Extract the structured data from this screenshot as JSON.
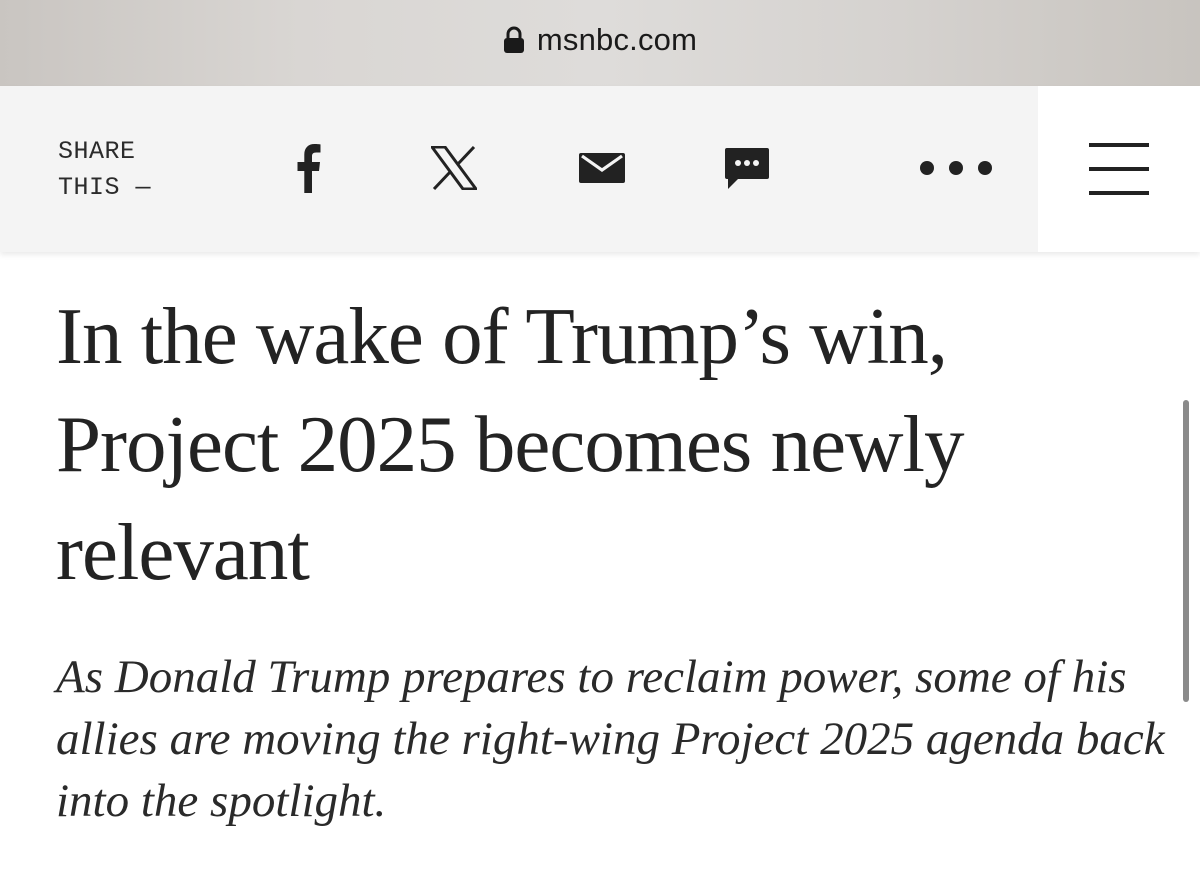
{
  "browser": {
    "url": "msnbc.com",
    "lock_icon": "lock-icon"
  },
  "share_bar": {
    "label_line1": "SHARE",
    "label_line2": "THIS —",
    "icons": [
      "facebook-icon",
      "x-icon",
      "mail-icon",
      "sms-icon",
      "more-icon"
    ],
    "menu_icon": "hamburger-menu-icon"
  },
  "article": {
    "headline": "In the wake of Trump’s win, Project 2025 becomes newly relevant",
    "dek": "As Donald Trump prepares to reclaim power, some of his allies are moving the right-wing Project 2025 agenda back into the spotlight."
  },
  "colors": {
    "text": "#232323",
    "share_bar_bg": "#f4f4f4",
    "menu_bg": "#ffffff"
  }
}
